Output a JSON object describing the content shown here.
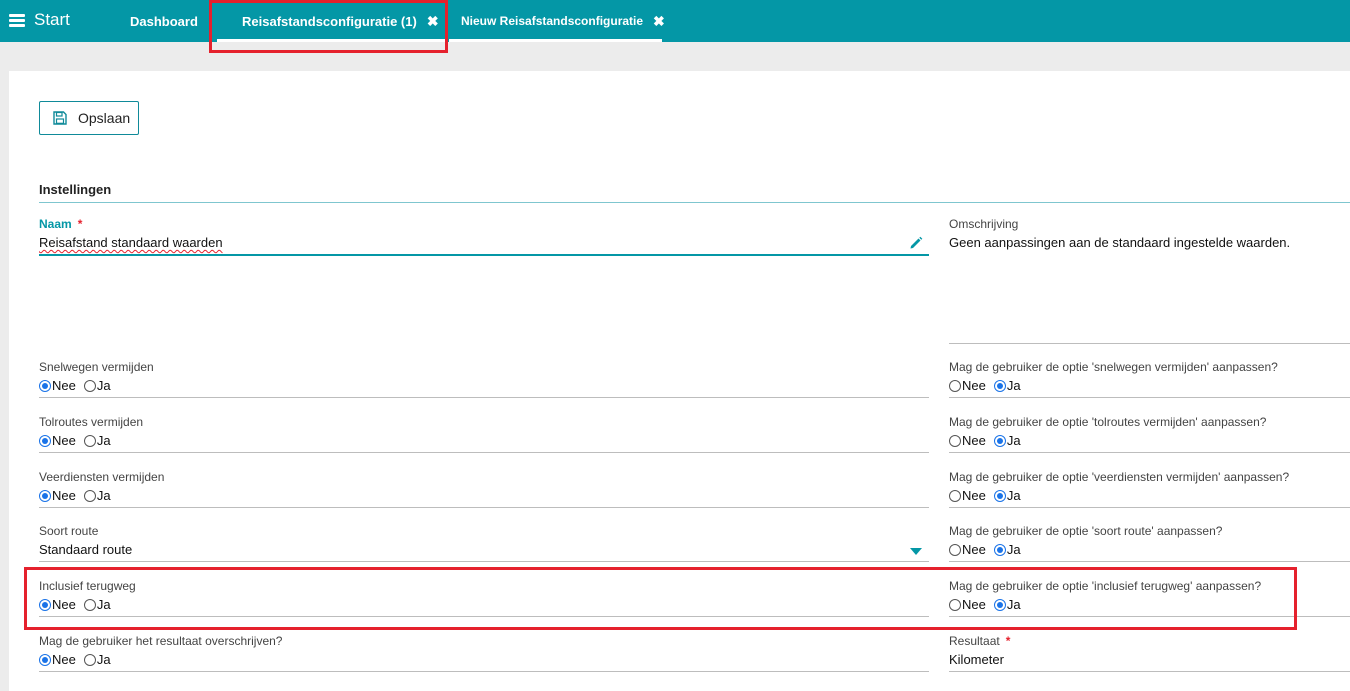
{
  "nav": {
    "start_label": "Start",
    "tabs": [
      {
        "label": "Dashboard",
        "closable": false,
        "active": false
      },
      {
        "label": "Reisafstandsconfiguratie (1)",
        "closable": true,
        "active": true,
        "close_glyph": "✖"
      },
      {
        "label": "Nieuw Reisafstandsconfiguratie",
        "closable": true,
        "active": false,
        "close_glyph": "✖"
      }
    ]
  },
  "toolbar": {
    "save_label": "Opslaan",
    "save_icon": "floppy-disk-icon"
  },
  "section": {
    "title": "Instellingen"
  },
  "form": {
    "naam": {
      "label": "Naam",
      "required_mark": "*",
      "value": "Reisafstand standaard waarden",
      "edit_icon": "pencil-icon"
    },
    "omschrijving": {
      "label": "Omschrijving",
      "value": "Geen aanpassingen aan de standaard ingestelde waarden."
    },
    "snelwegen": {
      "label": "Snelwegen vermijden",
      "options": [
        "Nee",
        "Ja"
      ],
      "selected": "Nee",
      "user_label": "Mag de gebruiker de optie 'snelwegen vermijden' aanpassen?",
      "user_selected": "Ja"
    },
    "tolroutes": {
      "label": "Tolroutes vermijden",
      "options": [
        "Nee",
        "Ja"
      ],
      "selected": "Nee",
      "user_label": "Mag de gebruiker de optie 'tolroutes vermijden' aanpassen?",
      "user_selected": "Ja"
    },
    "veerdiensten": {
      "label": "Veerdiensten vermijden",
      "options": [
        "Nee",
        "Ja"
      ],
      "selected": "Nee",
      "user_label": "Mag de gebruiker de optie 'veerdiensten vermijden' aanpassen?",
      "user_selected": "Ja"
    },
    "soort_route": {
      "label": "Soort route",
      "value": "Standaard route",
      "dropdown_icon": "caret-down-icon",
      "user_label": "Mag de gebruiker de optie 'soort route' aanpassen?",
      "user_selected": "Ja"
    },
    "terugweg": {
      "label": "Inclusief terugweg",
      "options": [
        "Nee",
        "Ja"
      ],
      "selected": "Nee",
      "user_label": "Mag de gebruiker de optie 'inclusief terugweg' aanpassen?",
      "user_selected": "Ja"
    },
    "overschrijven": {
      "label": "Mag de gebruiker het resultaat overschrijven?",
      "options": [
        "Nee",
        "Ja"
      ],
      "selected": "Nee"
    },
    "resultaat": {
      "label": "Resultaat",
      "required_mark": "*",
      "value": "Kilometer"
    }
  },
  "colors": {
    "accent": "#0497a6",
    "highlight": "#e5212d",
    "radio_checked": "#1a73e8"
  }
}
